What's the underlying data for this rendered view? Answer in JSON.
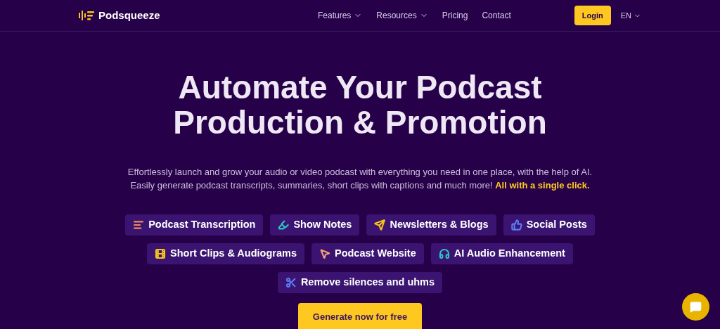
{
  "nav": {
    "logo": "Podsqueeze",
    "links": [
      {
        "label": "Features",
        "dropdown": true
      },
      {
        "label": "Resources",
        "dropdown": true
      },
      {
        "label": "Pricing",
        "dropdown": false
      },
      {
        "label": "Contact",
        "dropdown": false
      }
    ],
    "login": "Login",
    "language": "EN"
  },
  "hero": {
    "title_lines": [
      "Automate Your Podcast",
      "Production & Promotion"
    ],
    "subtitle_lines": [
      "Effortlessly launch and grow your audio or video podcast with everything you need in one place, with the help of AI.",
      "Easily generate podcast transcripts, summaries, short clips with captions and much more!"
    ],
    "highlight": "All with a single click."
  },
  "feature_rows": [
    [
      {
        "label": "Podcast Transcription",
        "kind": "lines",
        "color": "#f08a5d"
      },
      {
        "label": "Show Notes",
        "kind": "highlighter",
        "color": "#2ec4c4"
      },
      {
        "label": "Newsletters & Blogs",
        "kind": "send",
        "color": "#f5c518"
      },
      {
        "label": "Social Posts",
        "kind": "thumbs",
        "color": "#5b7cf5"
      }
    ],
    [
      {
        "label": "Short Clips & Audiograms",
        "kind": "film",
        "color": "#f5c518"
      },
      {
        "label": "Podcast Website",
        "kind": "pointer",
        "color": "#f4a07a"
      },
      {
        "label": "AI Audio Enhancement",
        "kind": "headphones",
        "color": "#2ec4c4"
      }
    ],
    [
      {
        "label": "Remove silences and uhms",
        "kind": "scissors",
        "color": "#5b7cf5"
      }
    ]
  ],
  "cta": "Generate now for free"
}
